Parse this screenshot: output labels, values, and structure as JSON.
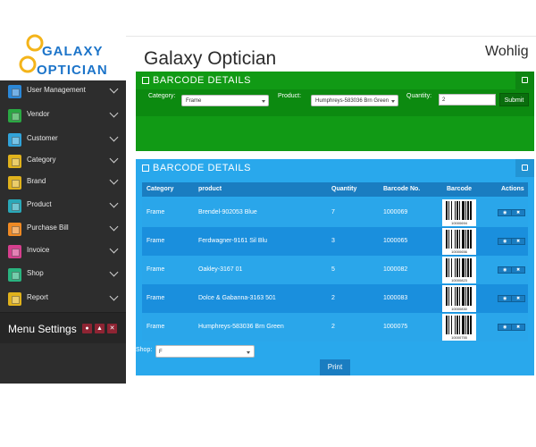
{
  "logo": {
    "line1": "GALAXY",
    "line2": "OPTICIAN"
  },
  "header": {
    "title": "Galaxy Optician",
    "user": "Wohlig"
  },
  "sidebar": {
    "items": [
      {
        "label": "User Management",
        "icon": "users-icon",
        "color": "#2b88d8"
      },
      {
        "label": "Vendor",
        "icon": "vendor-icon",
        "color": "#2aa843"
      },
      {
        "label": "Customer",
        "icon": "customer-icon",
        "color": "#31a3d9"
      },
      {
        "label": "Category",
        "icon": "tag-icon",
        "color": "#e0b21c"
      },
      {
        "label": "Brand",
        "icon": "brand-icon",
        "color": "#e0b21c"
      },
      {
        "label": "Product",
        "icon": "cube-icon",
        "color": "#2aa8b8"
      },
      {
        "label": "Purchase Bill",
        "icon": "cart-icon",
        "color": "#f08a24"
      },
      {
        "label": "Invoice",
        "icon": "invoice-icon",
        "color": "#d63f8e"
      },
      {
        "label": "Shop",
        "icon": "shop-icon",
        "color": "#2ab37f"
      },
      {
        "label": "Report",
        "icon": "report-icon",
        "color": "#e0b21c"
      }
    ],
    "settings_label": "Menu Settings"
  },
  "panel1": {
    "title": "BARCODE DETAILS",
    "category_label": "Category:",
    "category_value": "Frame",
    "product_label": "Product:",
    "product_value": "Humphreys-583036 Brn Green",
    "quantity_label": "Quantity:",
    "quantity_value": "2",
    "submit_label": "Submit"
  },
  "panel2": {
    "title": "BARCODE DETAILS",
    "columns": [
      "Category",
      "product",
      "Quantity",
      "Barcode No.",
      "Barcode",
      "Actions"
    ],
    "rows": [
      {
        "category": "Frame",
        "product": "Brendel-902053 Blue",
        "quantity": "7",
        "barcode_no": "1000069",
        "barcode_caption": "10000694"
      },
      {
        "category": "Frame",
        "product": "Ferdwagner-9161 Sil Blu",
        "quantity": "3",
        "barcode_no": "1000065",
        "barcode_caption": "10000656"
      },
      {
        "category": "Frame",
        "product": "Oakley-3167 01",
        "quantity": "5",
        "barcode_no": "1000082",
        "barcode_caption": "10000823"
      },
      {
        "category": "Frame",
        "product": "Dolce & Gabanna-3163 501",
        "quantity": "2",
        "barcode_no": "1000083",
        "barcode_caption": "10000830"
      },
      {
        "category": "Frame",
        "product": "Humphreys-583036 Brn Green",
        "quantity": "2",
        "barcode_no": "1000075",
        "barcode_caption": "10000755"
      }
    ],
    "shop_label": "Shop:",
    "shop_value": "F",
    "print_label": "Print"
  }
}
